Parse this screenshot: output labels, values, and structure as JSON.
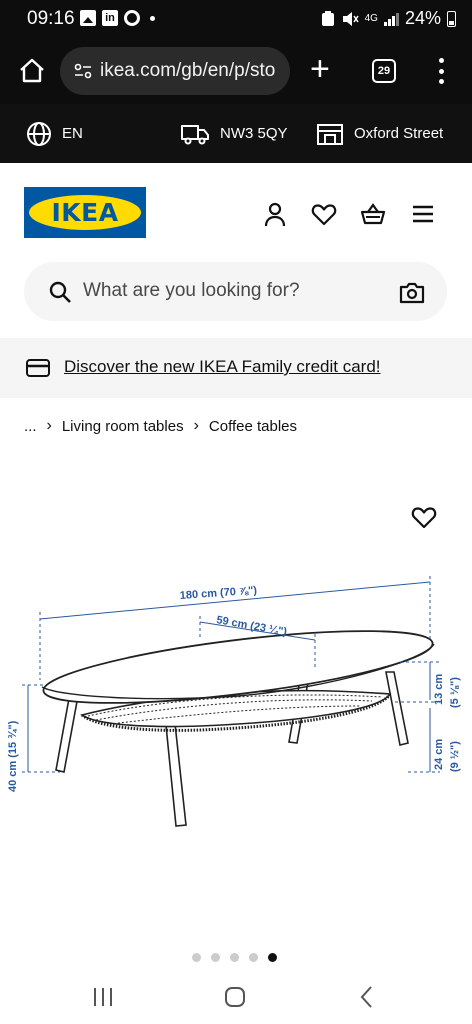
{
  "status_bar": {
    "time": "09:16",
    "icons": [
      "photo-icon",
      "linkedin-icon",
      "chrome-icon",
      "notification-dot"
    ],
    "network": "4G",
    "battery": "24%"
  },
  "browser": {
    "url": "ikea.com/gb/en/p/sto",
    "tab_count": "29"
  },
  "info_bar": {
    "language": "EN",
    "postcode": "NW3 5QY",
    "store": "Oxford Street"
  },
  "header": {
    "logo_text": "IKEA",
    "icons": [
      "user-icon",
      "heart-icon",
      "basket-icon",
      "menu-icon"
    ]
  },
  "search": {
    "placeholder": "What are you looking for?"
  },
  "promo": {
    "text": "Discover the new IKEA Family credit card!"
  },
  "breadcrumb": {
    "ellipsis": "...",
    "items": [
      "Living room tables",
      "Coffee tables"
    ]
  },
  "dimensions": {
    "length": "180 cm (70 ⅞\")",
    "depth": "59 cm (23 ¼\")",
    "height": "40 cm (15 ¾\")",
    "shelf_gap": "13 cm",
    "shelf_gap_in": "(5 ⅛\")",
    "shelf_height": "24 cm",
    "shelf_height_in": "(9 ½\")"
  },
  "carousel": {
    "total": 5,
    "active": 5
  },
  "colors": {
    "ikea_blue": "#0058a3",
    "ikea_yellow": "#ffdb00",
    "dimension_blue": "#2a5a9e",
    "dark_bar": "#111111"
  }
}
